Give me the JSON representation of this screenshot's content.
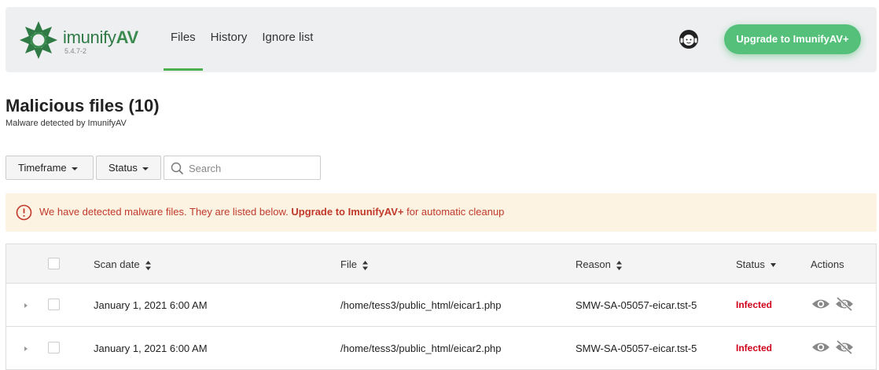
{
  "header": {
    "brand_main": "imunify",
    "brand_av": "AV",
    "version": "5.4.7-2",
    "tabs": [
      {
        "label": "Files",
        "active": true
      },
      {
        "label": "History",
        "active": false
      },
      {
        "label": "Ignore list",
        "active": false
      }
    ],
    "upgrade_label": "Upgrade to ImunifyAV+",
    "support_icon": "support-headset-icon"
  },
  "page": {
    "title": "Malicious files (10)",
    "subtitle": "Malware detected by ImunifyAV"
  },
  "filters": {
    "timeframe_label": "Timeframe",
    "status_label": "Status",
    "search_placeholder": "Search"
  },
  "alert": {
    "text_before": "We have detected malware files. They are listed below. ",
    "link_text": "Upgrade to ImunifyAV+",
    "text_after": " for automatic cleanup"
  },
  "table": {
    "columns": {
      "scan_date": "Scan date",
      "file": "File",
      "reason": "Reason",
      "status": "Status",
      "actions": "Actions"
    },
    "rows": [
      {
        "scan_date": "January 1, 2021 6:00 AM",
        "file": "/home/tess3/public_html/eicar1.php",
        "reason": "SMW-SA-05057-eicar.tst-5",
        "status": "Infected"
      },
      {
        "scan_date": "January 1, 2021 6:00 AM",
        "file": "/home/tess3/public_html/eicar2.php",
        "reason": "SMW-SA-05057-eicar.tst-5",
        "status": "Infected"
      }
    ]
  },
  "colors": {
    "brand_green": "#55c07a",
    "active_tab": "#4caf50",
    "infected": "#d0021b",
    "alert_bg": "#fdf3e2",
    "alert_text": "#c0392b"
  }
}
